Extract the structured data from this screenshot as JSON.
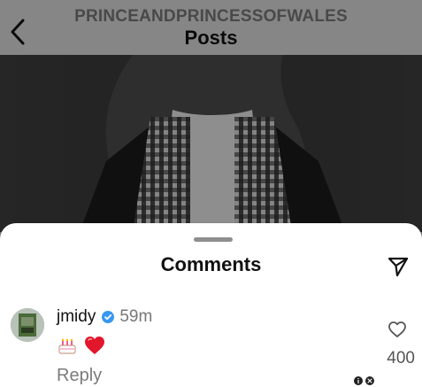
{
  "header": {
    "account_name": "PRINCEANDPRINCESSOFWALES",
    "title": "Posts",
    "back_icon": "chevron-left-icon"
  },
  "comments_sheet": {
    "title": "Comments",
    "share_icon": "send-icon",
    "comment": {
      "username": "jmidy",
      "verified": true,
      "timestamp": "59m",
      "emojis": [
        "cake-emoji",
        "red-heart-emoji"
      ],
      "reply_label": "Reply",
      "like_icon": "heart-outline-icon",
      "like_count": "400"
    }
  },
  "colors": {
    "sheet_background": "#ffffff",
    "verified_badge": "#3897f0",
    "heart_red": "#e3172b",
    "muted_text": "#777777"
  }
}
